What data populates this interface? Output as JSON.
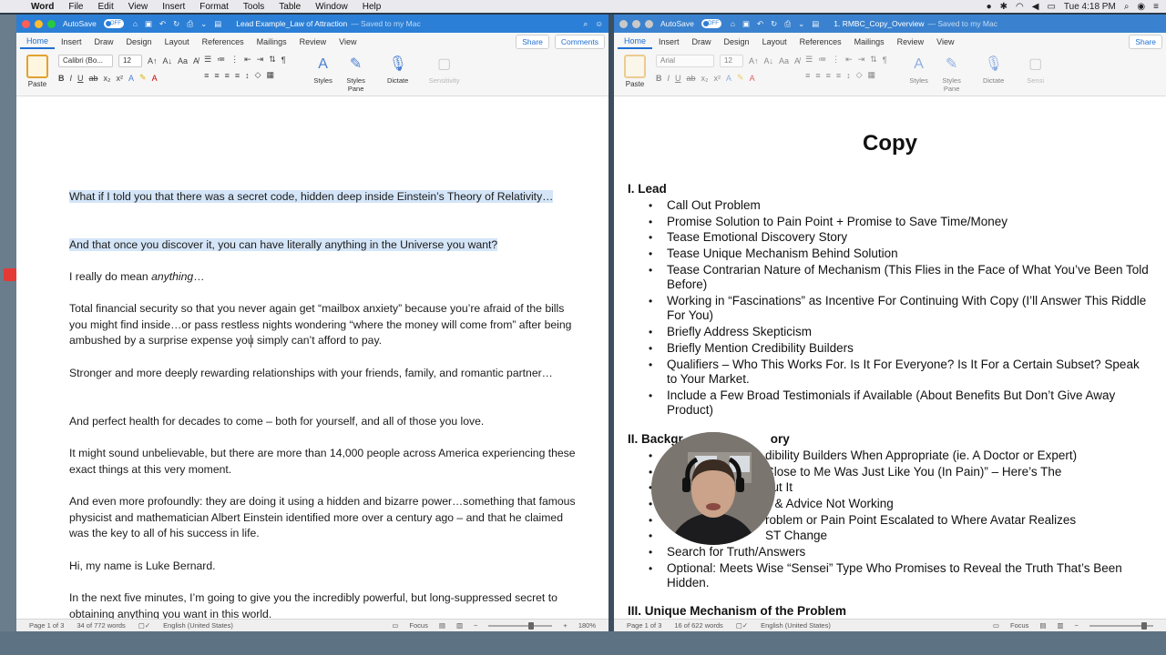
{
  "menubar": {
    "app": "Word",
    "items": [
      "File",
      "Edit",
      "View",
      "Insert",
      "Format",
      "Tools",
      "Table",
      "Window",
      "Help"
    ],
    "clock": "Tue 4:18 PM"
  },
  "left": {
    "autosave": "AutoSave",
    "toggle": "OFF",
    "title": "Lead Example_Law of Attraction",
    "saved": "— Saved to my Mac",
    "tabs": [
      "Home",
      "Insert",
      "Draw",
      "Design",
      "Layout",
      "References",
      "Mailings",
      "Review",
      "View"
    ],
    "share": "Share",
    "comments": "Comments",
    "ribbon": {
      "paste": "Paste",
      "font": "Calibri (Bo...",
      "size": "12",
      "styles": "Styles",
      "styles_pane": "Styles Pane",
      "dictate": "Dictate",
      "sensitivity": "Sensitivity"
    },
    "paragraphs": [
      "What if I told you that there was a secret code, hidden deep inside Einstein’s Theory of Relativity…",
      "And that once you discover it, you can have literally anything in the Universe you want?",
      "I really do mean anything…",
      "Total financial security so that you never again get “mailbox anxiety” because you’re afraid of the bills you might find inside…or pass restless nights wondering “where the money will come from” after being ambushed by a surprise expense you simply can’t afford to pay.",
      "Stronger and more deeply rewarding relationships with your friends, family, and romantic partner…",
      "And perfect health for decades to come – both for yourself, and all of those you love.",
      "It might sound unbelievable, but there are more than 14,000 people across America experiencing these exact things at this very moment.",
      "And even more profoundly: they are doing it using a hidden and bizarre power…something that famous physicist and mathematician Albert Einstein identified more over a century ago – and that he claimed was the key to all of his success in life.",
      "Hi, my name is Luke Bernard.",
      "In the next five minutes, I’m going to give you the incredibly powerful, but long-suppressed secret to obtaining anything you want in this world."
    ],
    "status": {
      "page": "Page 1 of 3",
      "words": "34 of 772 words",
      "lang": "English (United States)",
      "focus": "Focus",
      "zoom": "180%",
      "zoom_level": 0.62
    }
  },
  "right": {
    "autosave": "AutoSave",
    "toggle": "OFF",
    "title": "1. RMBC_Copy_Overview",
    "saved": "— Saved to my Mac",
    "tabs": [
      "Home",
      "Insert",
      "Draw",
      "Design",
      "Layout",
      "References",
      "Mailings",
      "Review",
      "View"
    ],
    "share": "Share",
    "ribbon": {
      "paste": "Paste",
      "font": "Arial",
      "size": "12",
      "styles": "Styles",
      "styles_pane": "Styles Pane",
      "dictate": "Dictate",
      "sensitivity": "Sensi"
    },
    "doc_title": "Copy",
    "sections": [
      {
        "heading": "I. Lead",
        "items": [
          "Call Out Problem",
          "Promise Solution to Pain Point + Promise to Save Time/Money",
          "Tease Emotional Discovery Story",
          "Tease Unique Mechanism Behind Solution",
          "Tease Contrarian Nature of Mechanism (This Flies in the Face of What You’ve Been Told Before)",
          "Working in “Fascinations” as Incentive For Continuing With Copy (I’ll Answer This Riddle For You)",
          "Briefly Address Skepticism",
          "Briefly Mention Credibility Builders",
          "Qualifiers – Who This Works For. Is It For Everyone? Is It For a Certain Subset? Speak to Your Market.",
          "Include a Few Broad Testimonials if Available (About Benefits But Don’t Give Away Product)"
        ]
      },
      {
        "heading": "II. Backgr",
        "heading_tail": "ory",
        "items": [
          "dibility Builders When Appropriate (ie. A Doctor or Expert)",
          "Close to Me Was Just Like You (In Pain)” – Here’s The",
          "out It",
          "s & Advice Not Working",
          "roblem or Pain Point Escalated to Where Avatar Realizes",
          "ST Change",
          "Search for Truth/Answers",
          "Optional: Meets Wise “Sensei” Type Who Promises to Reveal the Truth That’s Been Hidden."
        ]
      },
      {
        "heading": "III. Unique Mechanism of the Problem",
        "items": []
      }
    ],
    "status": {
      "page": "Page 1 of 3",
      "words": "16 of 622 words",
      "lang": "English (United States)",
      "focus": "Focus",
      "zoom_level": 0.82
    }
  }
}
